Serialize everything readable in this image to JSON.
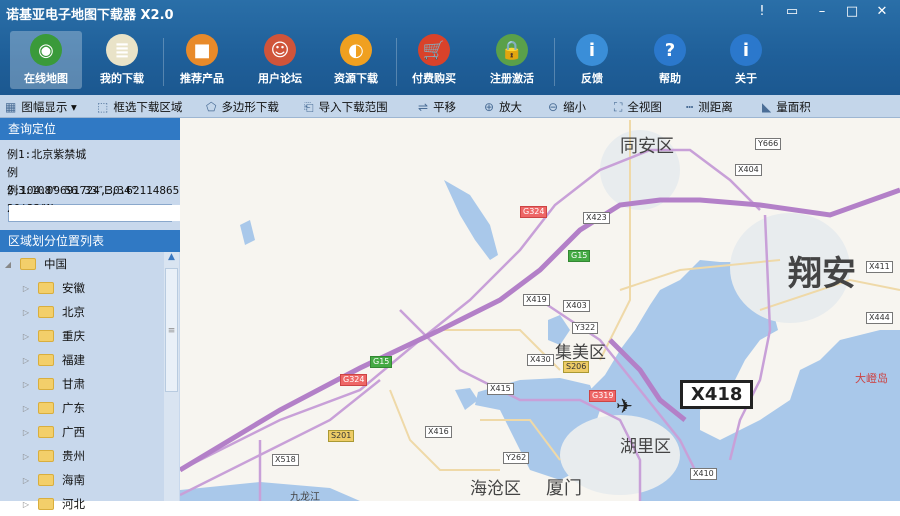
{
  "app": {
    "title": "诺基亚电子地图下载器 X2.0"
  },
  "window_controls": {
    "info": "!",
    "skin": "▭",
    "minimize": "–",
    "maximize": "□",
    "close": "✕"
  },
  "main_toolbar": [
    {
      "label": "在线地图",
      "icon": "globe-icon",
      "color": "#3a9a3a",
      "glyph": "◉"
    },
    {
      "label": "我的下载",
      "icon": "download-list-icon",
      "color": "#e9e3c8",
      "glyph": "≣"
    },
    {
      "label": "推荐产品",
      "icon": "cubes-icon",
      "color": "#e88a2a",
      "glyph": "■"
    },
    {
      "label": "用户论坛",
      "icon": "users-icon",
      "color": "#d0543a",
      "glyph": "☺"
    },
    {
      "label": "资源下载",
      "icon": "resource-icon",
      "color": "#f0a020",
      "glyph": "◐"
    },
    {
      "label": "付费购买",
      "icon": "cart-icon",
      "color": "#d9422a",
      "glyph": "🛒"
    },
    {
      "label": "注册激活",
      "icon": "lock-icon",
      "color": "#5aa04a",
      "glyph": "🔒"
    },
    {
      "label": "反馈",
      "icon": "feedback-icon",
      "color": "#3a8ed8",
      "glyph": "i"
    },
    {
      "label": "帮助",
      "icon": "help-icon",
      "color": "#2b78cc",
      "glyph": "?"
    },
    {
      "label": "关于",
      "icon": "about-icon",
      "color": "#2b78cc",
      "glyph": "i"
    }
  ],
  "sub_toolbar": [
    {
      "label": "图幅显示 ▾",
      "icon": "grid-icon",
      "glyph": "▦"
    },
    {
      "label": "框选下载区域",
      "icon": "box-select-icon",
      "glyph": "⬚"
    },
    {
      "label": "多边形下载",
      "icon": "polygon-icon",
      "glyph": "⬠"
    },
    {
      "label": "导入下载范围",
      "icon": "import-icon",
      "glyph": "⎗"
    },
    {
      "label": "平移",
      "icon": "pan-icon",
      "glyph": "⇌"
    },
    {
      "label": "放大",
      "icon": "zoom-in-icon",
      "glyph": "⊕"
    },
    {
      "label": "缩小",
      "icon": "zoom-out-icon",
      "glyph": "⊖"
    },
    {
      "label": "全视图",
      "icon": "full-view-icon",
      "glyph": "⛶"
    },
    {
      "label": "测距离",
      "icon": "ruler-icon",
      "glyph": "┅"
    },
    {
      "label": "量面积",
      "icon": "area-icon",
      "glyph": "◣"
    }
  ],
  "query": {
    "header": "查询定位",
    "examples": [
      "例1:北京紫禁城",
      "例2:104.09691724,30.62114865",
      "例3:108° 56′33″E,34° 20′33″N"
    ],
    "input_value": ""
  },
  "region": {
    "header": "区域划分位置列表",
    "root": "中国",
    "children": [
      "安徽",
      "北京",
      "重庆",
      "福建",
      "甘肃",
      "广东",
      "广西",
      "贵州",
      "海南",
      "河北"
    ]
  },
  "map": {
    "districts": [
      "同安区",
      "翔安",
      "集美区",
      "湖里区",
      "海沧区",
      "厦门",
      "大嶝岛",
      "九龙江"
    ],
    "shields": [
      "G324",
      "X423",
      "G15",
      "X419",
      "X403",
      "Y322",
      "X430",
      "S206",
      "G15",
      "G324",
      "X415",
      "G319",
      "X416",
      "S201",
      "X518",
      "Y262",
      "X410",
      "Y666",
      "X404",
      "X411",
      "X444"
    ],
    "highlight": "X418"
  }
}
